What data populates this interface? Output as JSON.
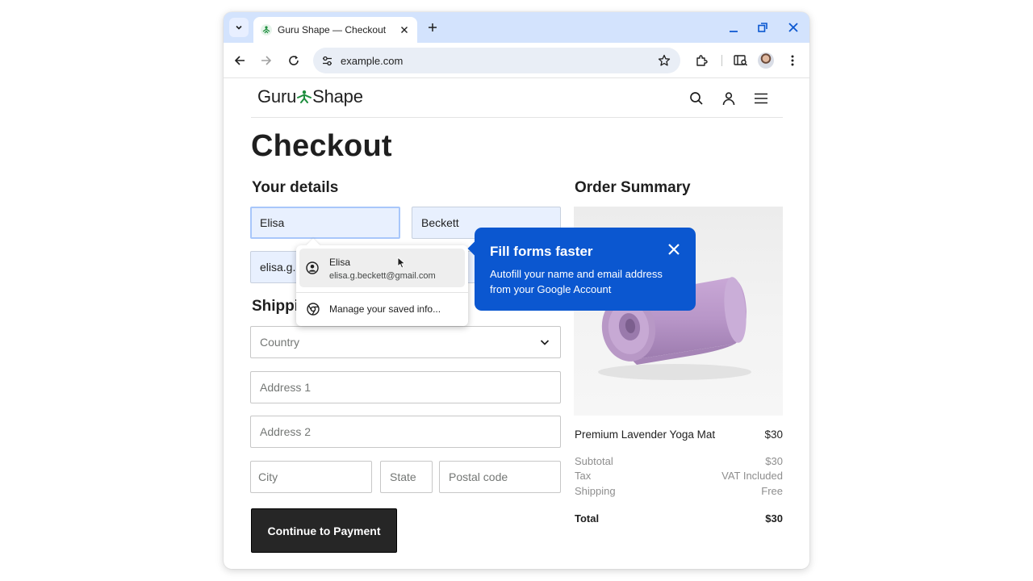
{
  "browser": {
    "tab_title": "Guru Shape — Checkout",
    "url": "example.com"
  },
  "site": {
    "logo_left": "Guru",
    "logo_right": "Shape"
  },
  "page": {
    "title": "Checkout",
    "your_details_heading": "Your details",
    "shipping_heading": "Shipping",
    "order_summary_heading": "Order Summary"
  },
  "form": {
    "first_name": "Elisa",
    "last_name": "Beckett",
    "email_partial": "elisa.g.",
    "country_placeholder": "Country",
    "address1_placeholder": "Address 1",
    "address2_placeholder": "Address 2",
    "city_placeholder": "City",
    "state_placeholder": "State",
    "postal_placeholder": "Postal code",
    "submit_label": "Continue to Payment"
  },
  "autofill_dropdown": {
    "suggestion_name": "Elisa",
    "suggestion_email": "elisa.g.beckett@gmail.com",
    "manage_label": "Manage your saved info..."
  },
  "iph_bubble": {
    "title": "Fill forms faster",
    "body": "Autofill your name and email address from your Google Account"
  },
  "order_summary": {
    "product_name": "Premium Lavender Yoga Mat",
    "product_price": "$30",
    "subtotal_label": "Subtotal",
    "subtotal_value": "$30",
    "tax_label": "Tax",
    "tax_value": "VAT Included",
    "shipping_label": "Shipping",
    "shipping_value": "Free",
    "total_label": "Total",
    "total_value": "$30"
  },
  "colors": {
    "tabstrip": "#d3e3fd",
    "bubble": "#0b57d0",
    "autofill_bg": "#e8f0fe",
    "button": "#262626",
    "logo_green": "#1e8e3e"
  },
  "icons": [
    "tab-search-icon",
    "site-favicon",
    "close-icon",
    "plus-icon",
    "minimize-icon",
    "restore-icon",
    "back-icon",
    "forward-icon",
    "reload-icon",
    "site-settings-icon",
    "star-icon",
    "extensions-icon",
    "tab-search-sidepanel-icon",
    "more-icon",
    "search-icon",
    "account-icon",
    "menu-icon",
    "chevron-down-icon",
    "person-circle-icon",
    "chrome-icon",
    "cursor-icon"
  ]
}
